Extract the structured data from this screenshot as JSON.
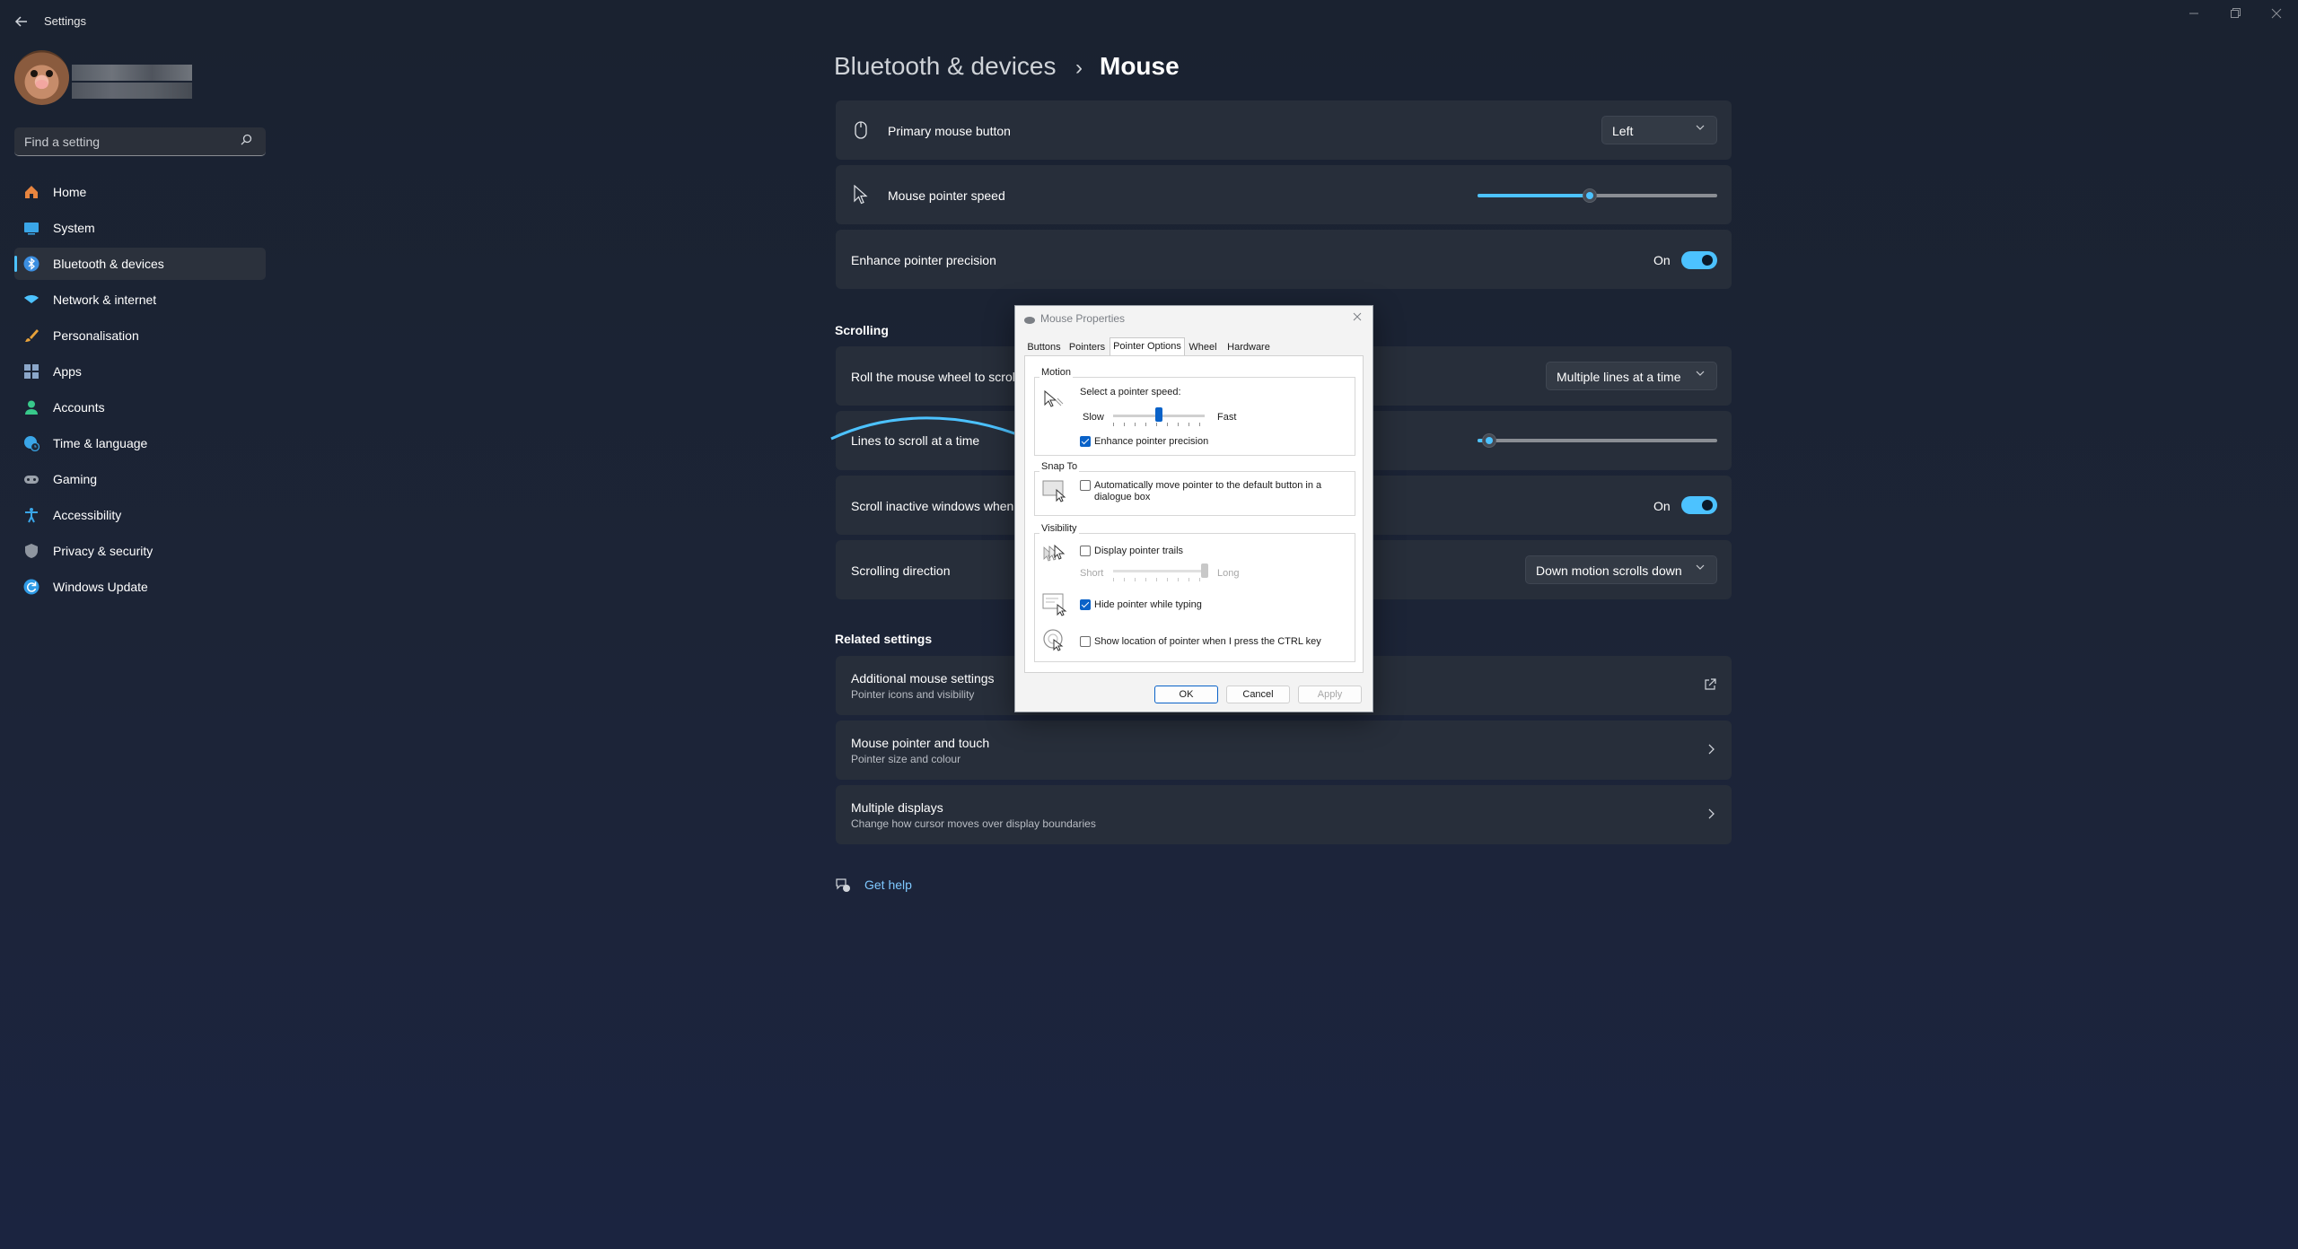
{
  "window": {
    "title": "Settings",
    "controls": [
      "minimize",
      "restore",
      "close"
    ]
  },
  "sidebar": {
    "search_placeholder": "Find a setting",
    "items": [
      {
        "label": "Home",
        "icon": "home-icon",
        "color": "#e8853f"
      },
      {
        "label": "System",
        "icon": "system-icon",
        "color": "#3aa6e8"
      },
      {
        "label": "Bluetooth & devices",
        "icon": "bluetooth-icon",
        "color": "#3b8ee0",
        "active": true
      },
      {
        "label": "Network & internet",
        "icon": "wifi-icon",
        "color": "#4cc2ff"
      },
      {
        "label": "Personalisation",
        "icon": "brush-icon",
        "color": "#e8a23a"
      },
      {
        "label": "Apps",
        "icon": "apps-icon",
        "color": "#8ba6c9"
      },
      {
        "label": "Accounts",
        "icon": "person-icon",
        "color": "#38c98b"
      },
      {
        "label": "Time & language",
        "icon": "globe-clock-icon",
        "color": "#3aa6e8"
      },
      {
        "label": "Gaming",
        "icon": "gamepad-icon",
        "color": "#9aa1ab"
      },
      {
        "label": "Accessibility",
        "icon": "accessibility-icon",
        "color": "#3aa6e8"
      },
      {
        "label": "Privacy & security",
        "icon": "shield-icon",
        "color": "#8f96a0"
      },
      {
        "label": "Windows Update",
        "icon": "update-icon",
        "color": "#2f9be6"
      }
    ]
  },
  "main": {
    "breadcrumb_parent": "Bluetooth & devices",
    "breadcrumb_current": "Mouse",
    "primary_button": {
      "label": "Primary mouse button",
      "value": "Left"
    },
    "pointer_speed": {
      "label": "Mouse pointer speed",
      "level": 0.47
    },
    "enhance": {
      "label": "Enhance pointer precision",
      "state": "On"
    },
    "scrolling_header": "Scrolling",
    "roll_wheel": {
      "label": "Roll the mouse wheel to scroll",
      "value": "Multiple lines at a time"
    },
    "lines_to_scroll": {
      "label": "Lines to scroll at a time",
      "level": 0.05
    },
    "scroll_inactive": {
      "label": "Scroll inactive windows when hovering over them",
      "state": "On"
    },
    "scroll_direction": {
      "label": "Scrolling direction",
      "value": "Down motion scrolls down"
    },
    "related_header": "Related settings",
    "related": [
      {
        "title": "Additional mouse settings",
        "subtitle": "Pointer icons and visibility",
        "icon": "external-link-icon"
      },
      {
        "title": "Mouse pointer and touch",
        "subtitle": "Pointer size and colour",
        "icon": "chevron-right-icon"
      },
      {
        "title": "Multiple displays",
        "subtitle": "Change how cursor moves over display boundaries",
        "icon": "chevron-right-icon"
      }
    ],
    "help": "Get help",
    "accent": "#4cc2ff"
  },
  "dialog": {
    "title": "Mouse Properties",
    "tabs": [
      "Buttons",
      "Pointers",
      "Pointer Options",
      "Wheel",
      "Hardware"
    ],
    "active_tab": "Pointer Options",
    "motion": {
      "label": "Motion",
      "speed_label": "Select a pointer speed:",
      "slow": "Slow",
      "fast": "Fast",
      "speed_level": 0.5,
      "enhance": {
        "label": "Enhance pointer precision",
        "checked": true
      }
    },
    "snap": {
      "label": "Snap To",
      "auto_move": {
        "line1": "Automatically move pointer to the default button in a",
        "line2": "dialogue box",
        "checked": false
      }
    },
    "visibility": {
      "label": "Visibility",
      "trails": {
        "label": "Display pointer trails",
        "checked": false
      },
      "short": "Short",
      "long": "Long",
      "trails_level": 1.0,
      "hide": {
        "label": "Hide pointer while typing",
        "checked": true
      },
      "ctrl": {
        "label": "Show location of pointer when I press the CTRL key",
        "checked": false
      }
    },
    "buttons": {
      "ok": "OK",
      "cancel": "Cancel",
      "apply": "Apply"
    }
  }
}
